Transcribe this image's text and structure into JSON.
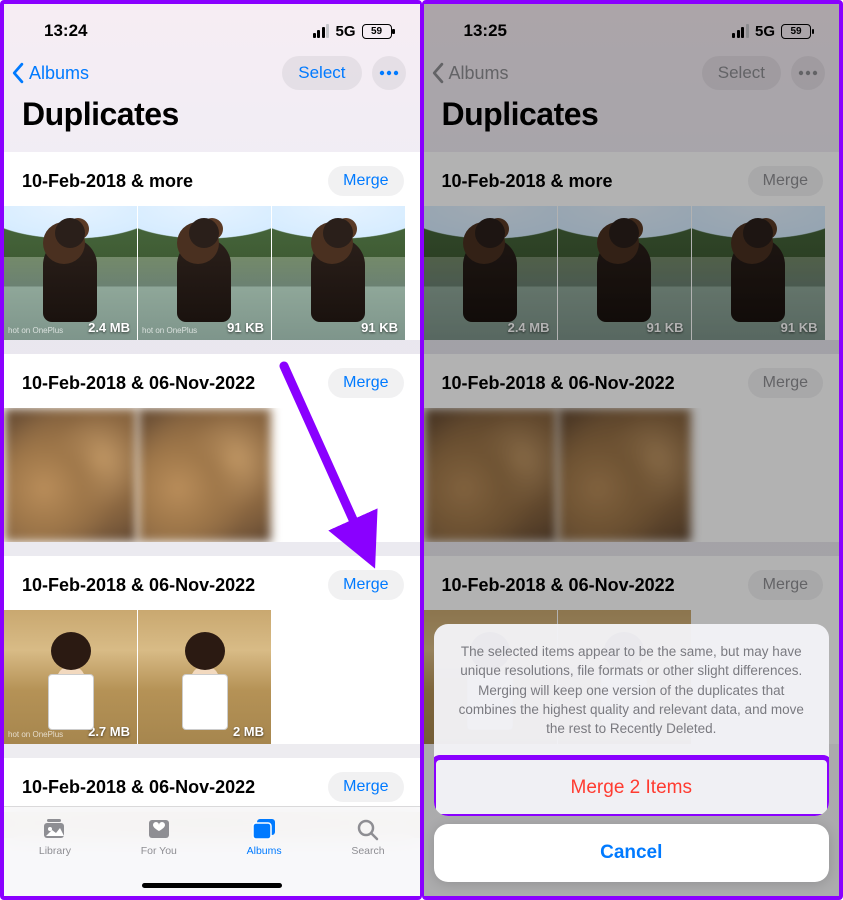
{
  "screen1": {
    "status_time": "13:24",
    "network": "5G",
    "battery": "59",
    "nav_back": "Albums",
    "nav_select": "Select",
    "title": "Duplicates",
    "groups": [
      {
        "label": "10-Feb-2018 & more",
        "merge": "Merge",
        "sizes": [
          "2.4 MB",
          "91 KB",
          "91 KB"
        ]
      },
      {
        "label": "10-Feb-2018 & 06-Nov-2022",
        "merge": "Merge",
        "sizes": []
      },
      {
        "label": "10-Feb-2018 & 06-Nov-2022",
        "merge": "Merge",
        "sizes": [
          "2.7 MB",
          "2 MB"
        ]
      },
      {
        "label": "10-Feb-2018 & 06-Nov-2022",
        "merge": "Merge",
        "sizes": []
      }
    ],
    "tabs": {
      "library": "Library",
      "foryou": "For You",
      "albums": "Albums",
      "search": "Search"
    }
  },
  "screen2": {
    "status_time": "13:25",
    "network": "5G",
    "battery": "59",
    "nav_back": "Albums",
    "nav_select": "Select",
    "title": "Duplicates",
    "groups": [
      {
        "label": "10-Feb-2018 & more",
        "merge": "Merge",
        "sizes": [
          "2.4 MB",
          "91 KB",
          "91 KB"
        ]
      },
      {
        "label": "10-Feb-2018 & 06-Nov-2022",
        "merge": "Merge",
        "sizes": []
      },
      {
        "label": "10-Feb-2018 & 06-Nov-2022",
        "merge": "Merge",
        "sizes": []
      }
    ],
    "sheet": {
      "message": "The selected items appear to be the same, but may have unique resolutions, file formats or other slight differences. Merging will keep one version of the duplicates that combines the highest quality and relevant data, and move the rest to Recently Deleted.",
      "confirm": "Merge 2 Items",
      "cancel": "Cancel"
    }
  }
}
